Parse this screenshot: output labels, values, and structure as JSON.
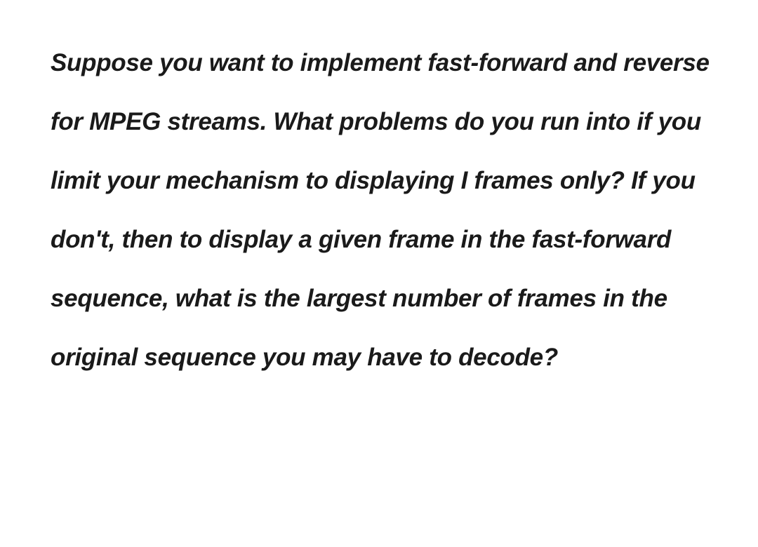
{
  "question": {
    "text": "Suppose you want to implement fast-forward and reverse for MPEG streams. What problems do you run into if you limit your mechanism to displaying I frames only? If you don't, then to display a given frame in the fast-forward sequence, what is the largest number of frames in the original sequence you may have to decode?"
  }
}
